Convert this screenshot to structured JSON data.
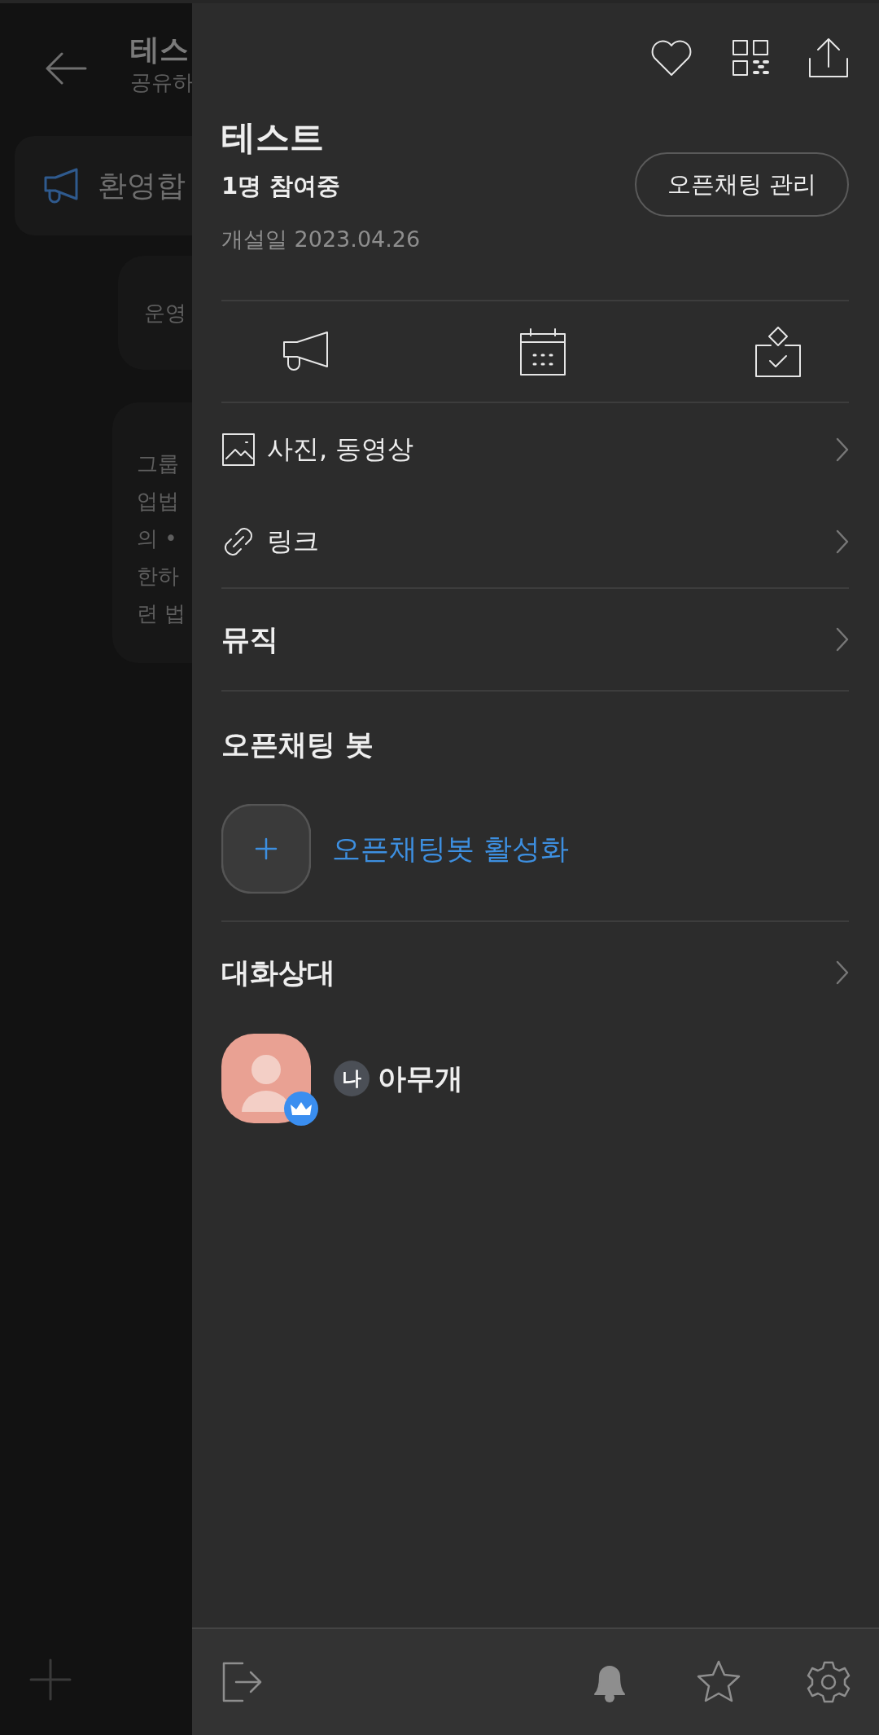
{
  "background_chat": {
    "title": "테스",
    "subtitle": "공유하",
    "notice": "환영합",
    "messages": [
      {
        "lines": [
          "운영"
        ]
      },
      {
        "lines": [
          "그룹",
          "업법",
          "의 •",
          "한하",
          "련 법"
        ]
      }
    ]
  },
  "drawer": {
    "title": "테스트",
    "members": "1명 참여중",
    "created": "개설일 2023.04.26",
    "manage_button": "오픈채팅 관리",
    "rows": [
      {
        "kind": "photo",
        "label": "사진, 동영상"
      },
      {
        "kind": "link",
        "label": "링크"
      },
      {
        "kind": "section",
        "label": "뮤직"
      }
    ],
    "bot_section": {
      "title": "오픈채팅 봇",
      "action": "오픈채팅봇 활성화"
    },
    "members_section": {
      "title": "대화상대",
      "people": [
        {
          "badge": "나",
          "name": "아무개",
          "owner": true
        }
      ]
    }
  },
  "bottom_bar": {
    "notifications_on": true
  }
}
